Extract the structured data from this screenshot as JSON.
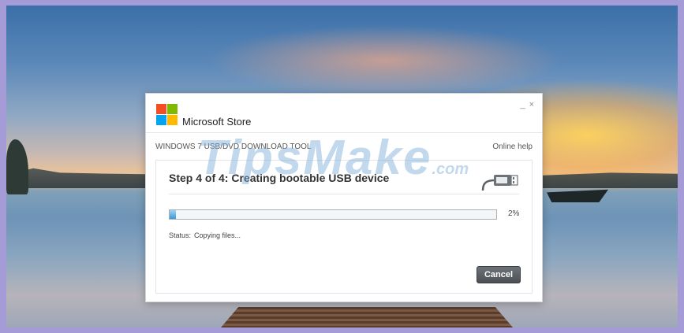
{
  "window": {
    "brand": "Microsoft Store",
    "minimize": "_",
    "close": "×"
  },
  "appbar": {
    "tool_name": "WINDOWS 7 USB/DVD DOWNLOAD TOOL",
    "help": "Online help"
  },
  "step": {
    "title": "Step 4 of 4: Creating bootable USB device",
    "icon": "usb-icon"
  },
  "progress": {
    "value": 0.02,
    "label": "2%"
  },
  "status": {
    "label": "Status:",
    "value": "Copying files..."
  },
  "buttons": {
    "cancel": "Cancel"
  },
  "watermark": {
    "text": "TipsMake",
    "suffix": ".com"
  },
  "colors": {
    "progress_fill": "#3a9ad6",
    "cancel_bg": "#5b6166"
  }
}
